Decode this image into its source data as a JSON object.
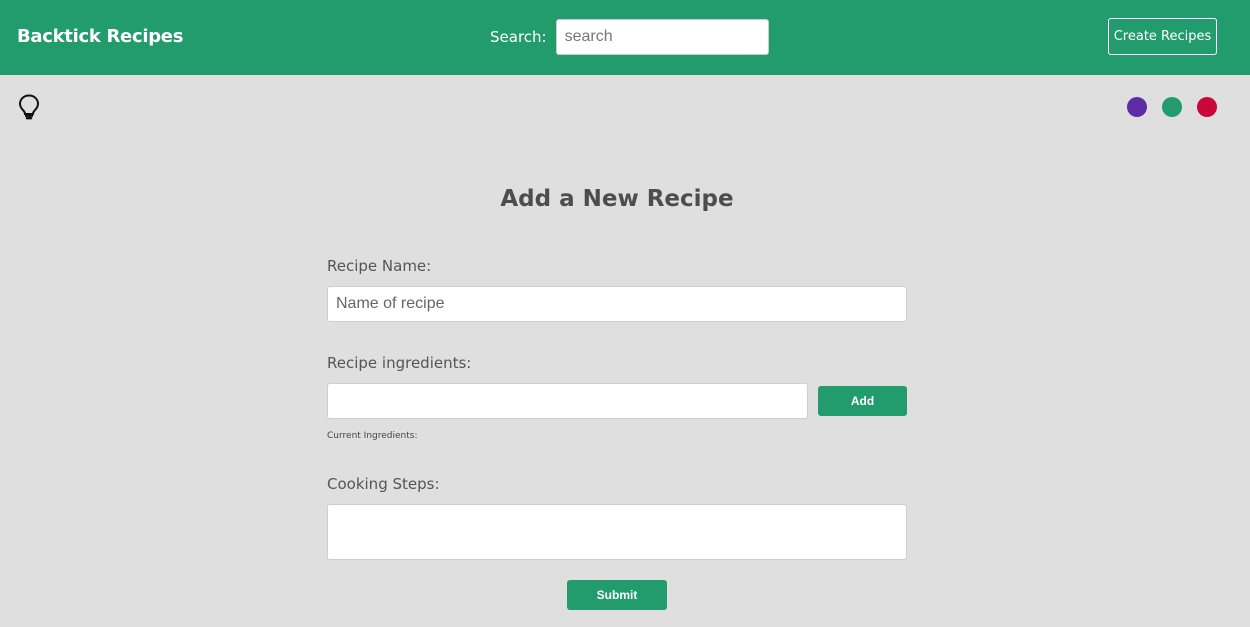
{
  "header": {
    "brand": "Backtick Recipes",
    "search_label": "Search:",
    "search_placeholder": "search",
    "create_button": "Create Recipes",
    "background_color": "#229c6c"
  },
  "toolbar": {
    "icon": "lightbulb-icon",
    "theme_colors": [
      "#5e2ca5",
      "#229c6c",
      "#c8083a"
    ]
  },
  "form": {
    "title": "Add a New Recipe",
    "name_label": "Recipe Name:",
    "name_placeholder": "Name of recipe",
    "name_value": "",
    "ingredients_label": "Recipe ingredients:",
    "ingredients_value": "",
    "add_button": "Add",
    "current_ingredients_label": "Current Ingredients:",
    "steps_label": "Cooking Steps:",
    "steps_value": "",
    "submit_button": "Submit"
  }
}
